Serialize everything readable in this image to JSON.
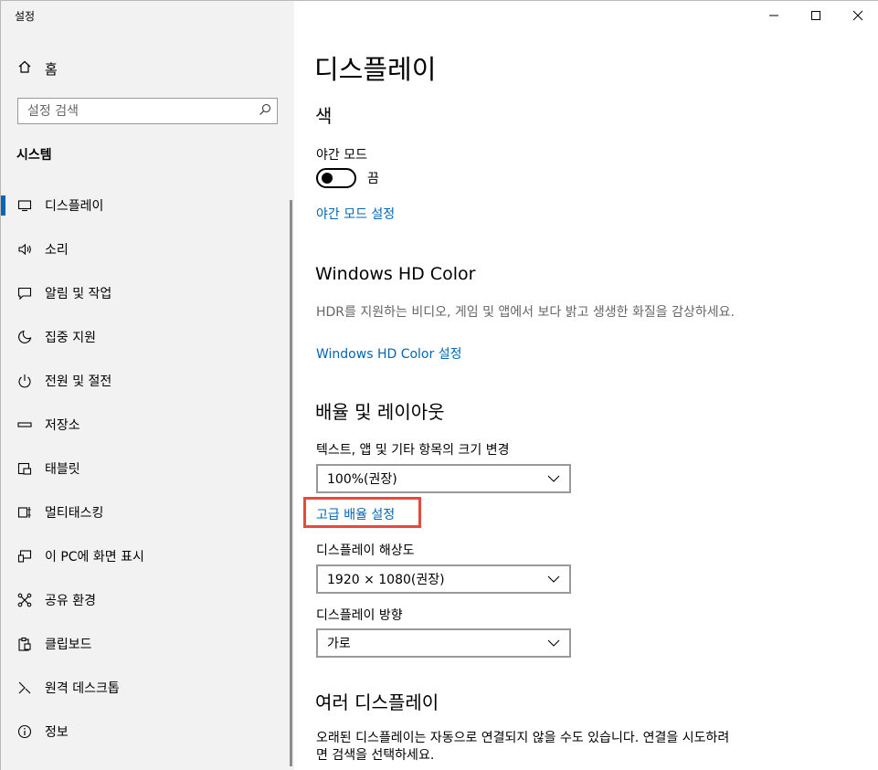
{
  "window": {
    "title": "설정",
    "controls": [
      "minimize-icon",
      "maximize-icon",
      "close-icon"
    ]
  },
  "sidebar": {
    "home_label": "홈",
    "search_placeholder": "설정 검색",
    "section": "시스템",
    "items": [
      {
        "label": "디스플레이",
        "icon": "monitor-icon",
        "active": true
      },
      {
        "label": "소리",
        "icon": "speaker-icon"
      },
      {
        "label": "알림 및 작업",
        "icon": "notification-icon"
      },
      {
        "label": "집중 지원",
        "icon": "moon-icon"
      },
      {
        "label": "전원 및 절전",
        "icon": "power-icon"
      },
      {
        "label": "저장소",
        "icon": "storage-icon"
      },
      {
        "label": "태블릿",
        "icon": "tablet-icon"
      },
      {
        "label": "멀티태스킹",
        "icon": "multitask-icon"
      },
      {
        "label": "이 PC에 화면 표시",
        "icon": "project-icon"
      },
      {
        "label": "공유 환경",
        "icon": "share-icon"
      },
      {
        "label": "클립보드",
        "icon": "clipboard-icon"
      },
      {
        "label": "원격 데스크톱",
        "icon": "remote-icon"
      },
      {
        "label": "정보",
        "icon": "info-icon"
      }
    ]
  },
  "main": {
    "title": "디스플레이",
    "color": {
      "heading": "색",
      "night_mode_label": "야간 모드",
      "night_mode_state": "끔",
      "night_mode_link": "야간 모드 설정"
    },
    "hdr": {
      "heading": "Windows HD Color",
      "description": "HDR를 지원하는 비디오, 게임 및 앱에서 보다 밝고 생생한 화질을 감상하세요.",
      "link": "Windows HD Color 설정"
    },
    "scale": {
      "heading": "배율 및 레이아웃",
      "text_size_label": "텍스트, 앱 및 기타 항목의 크기 변경",
      "text_size_value": "100%(권장)",
      "advanced_link": "고급 배율 설정",
      "resolution_label": "디스플레이 해상도",
      "resolution_value": "1920 × 1080(권장)",
      "orientation_label": "디스플레이 방향",
      "orientation_value": "가로"
    },
    "multi": {
      "heading": "여러 디스플레이",
      "description": "오래된 디스플레이는 자동으로 연결되지 않을 수도 있습니다. 연결을 시도하려면 검색을 선택하세요."
    }
  },
  "colors": {
    "accent": "#0067b8",
    "highlight": "#e64a3c",
    "sidebar_bg": "#f2f2f2"
  }
}
